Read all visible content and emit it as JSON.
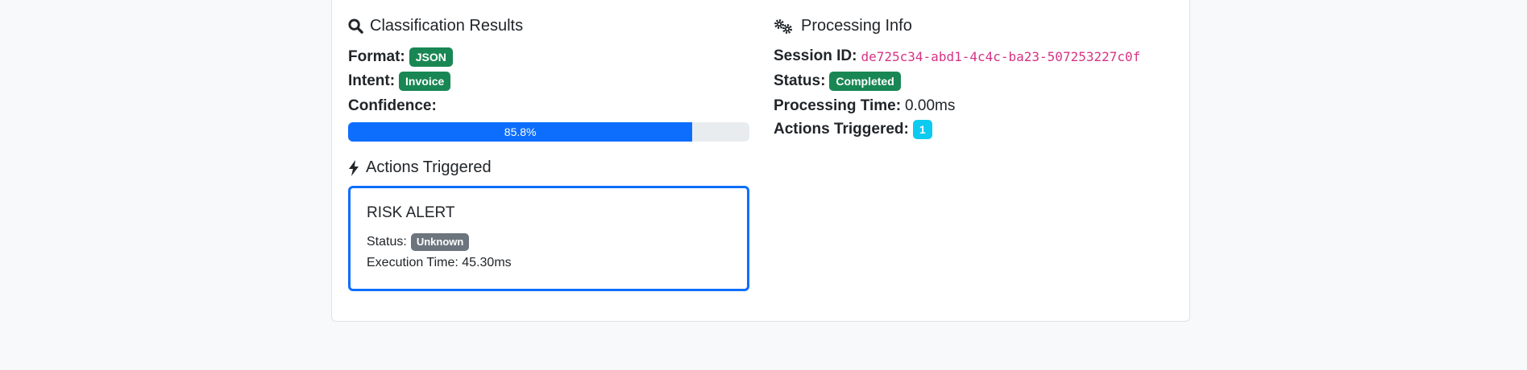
{
  "classification": {
    "title": "Classification Results",
    "icon": "search-icon",
    "format_label": "Format:",
    "format_value": "JSON",
    "intent_label": "Intent:",
    "intent_value": "Invoice",
    "confidence_label": "Confidence:",
    "confidence_percent": 85.8,
    "confidence_text": "85.8%"
  },
  "actions": {
    "title": "Actions Triggered",
    "icon": "bolt-icon",
    "items": [
      {
        "name": "RISK ALERT",
        "status_label": "Status:",
        "status": "Unknown",
        "execution_time": "Execution Time: 45.30ms"
      }
    ]
  },
  "processing": {
    "title": "Processing Info",
    "icon": "gears-icon",
    "session_label": "Session ID:",
    "session_id": "de725c34-abd1-4c4c-ba23-507253227c0f",
    "status_label": "Status:",
    "status": "Completed",
    "time_label": "Processing Time:",
    "time_value": "0.00ms",
    "actions_label": "Actions Triggered:",
    "actions_count": "1"
  },
  "colors": {
    "primary": "#0d6efd",
    "success": "#198754",
    "info": "#0dcaf0",
    "secondary": "#6c757d",
    "code": "#d63384"
  }
}
